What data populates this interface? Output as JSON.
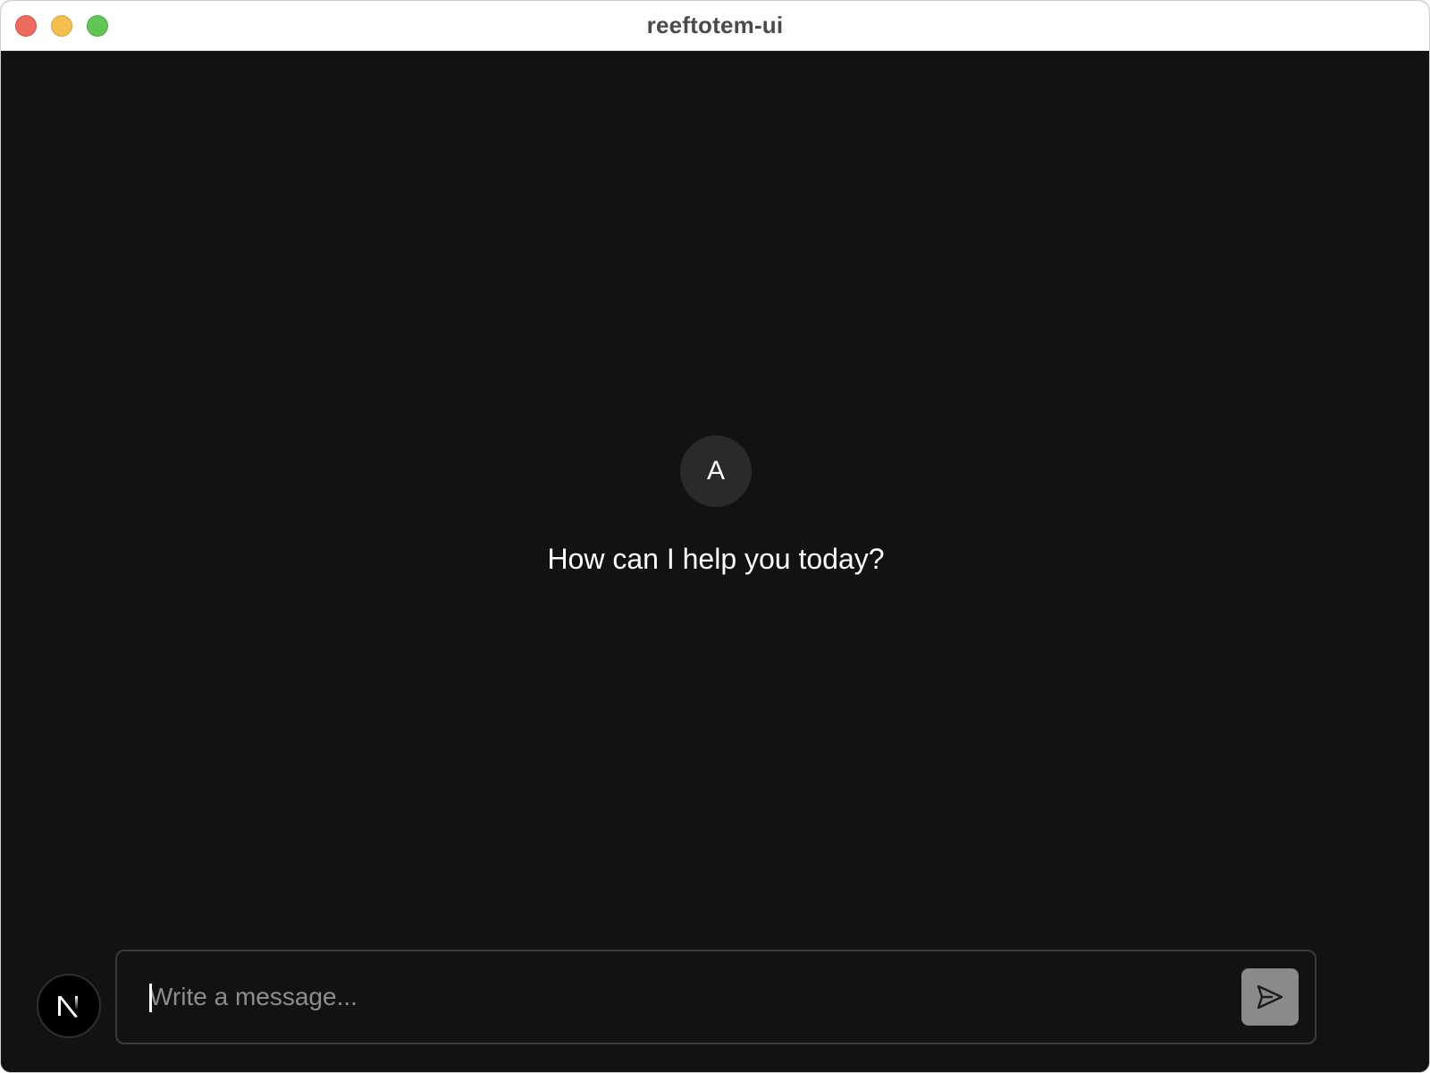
{
  "window": {
    "title": "reeftotem-ui"
  },
  "assistant": {
    "avatar_initial": "A",
    "greeting": "How can I help you today?"
  },
  "composer": {
    "placeholder": "Write a message...",
    "value": "",
    "send_icon": "paper-plane-icon"
  },
  "logo": {
    "icon": "nextjs-logo-icon"
  },
  "colors": {
    "background": "#121212",
    "titlebar": "#ffffff",
    "avatar_bg": "#2a2a2b",
    "send_button": "#8a8a8a",
    "close": "#ed6a5e",
    "minimize": "#f5bf4f",
    "zoom": "#61c554"
  }
}
